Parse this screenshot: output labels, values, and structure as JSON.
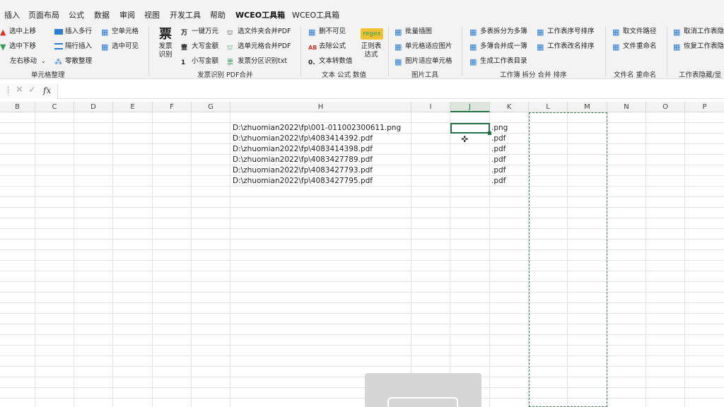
{
  "menu": {
    "items": [
      "插入",
      "页面布局",
      "公式",
      "数据",
      "审阅",
      "视图",
      "开发工具",
      "帮助",
      "WCEO工具箱",
      "WCEO工具箱"
    ]
  },
  "ribbon": {
    "cell_org": {
      "move_up": "选中上移",
      "move_down": "选中下移",
      "move_lr": "左右移动",
      "insert_rows": "插入多行",
      "interlace_insert": "隔行插入",
      "scatter_tidy": "零散整理",
      "empty_cells": "空单元格",
      "select_visible": "选中可见",
      "group_label": "单元格整理"
    },
    "invoice": {
      "invoice_icon": "票",
      "invoice_recognize": "发票识别",
      "one_key_wan": "一键万元",
      "upper_amount": "大写金额",
      "lower_amount": "小写金额",
      "folder_pdf": "选文件夹合并PDF",
      "cells_pdf": "选单元格合并PDF",
      "invoice_txt": "发票分区识别txt",
      "group_label": "发票识别 PDF合并"
    },
    "text": {
      "del_invisible": "删不可见",
      "remove_formula": "去除公式",
      "text_to_num": "文本转数值",
      "regex_icon": "regex",
      "regex_label": "正则表达式",
      "group_label": "文本 公式 数值"
    },
    "image": {
      "batch_insert": "批量插图",
      "cell_fit_image": "单元格适应图片",
      "image_fit_cell": "图片适应单元格",
      "group_label": "图片工具"
    },
    "workbook": {
      "split_multi": "多表拆分为多簿",
      "merge_multi": "多簿合并成一簿",
      "gen_dir": "生成工作表目录",
      "sort_order": "工作表序号排序",
      "sort_name": "工作表改名排序",
      "group_label": "工作簿 拆分 合并 排序"
    },
    "filename": {
      "get_path": "取文件路径",
      "rename": "文件重命名",
      "group_label": "文件名 重命名"
    },
    "sheet": {
      "cancel_hide": "取消工作表隐",
      "restore_hide": "恢复工作表隐",
      "group_label": "工作表隐藏/显"
    }
  },
  "formula_bar": {
    "fx": "fx",
    "value": ""
  },
  "columns": [
    "B",
    "C",
    "D",
    "E",
    "F",
    "G",
    "H",
    "I",
    "J",
    "K",
    "L",
    "M",
    "N",
    "O",
    "P"
  ],
  "sheet": {
    "paths": [
      "D:\\zhuomian2022\\fp\\001-011002300611.png",
      "D:\\zhuomian2022\\fp\\4083414392.pdf",
      "D:\\zhuomian2022\\fp\\4083414398.pdf",
      "D:\\zhuomian2022\\fp\\4083427789.pdf",
      "D:\\zhuomian2022\\fp\\4083427793.pdf",
      "D:\\zhuomian2022\\fp\\4083427795.pdf"
    ],
    "extensions": [
      ".png",
      ".pdf",
      ".pdf",
      ".pdf",
      ".pdf",
      ".pdf"
    ]
  },
  "colors": {
    "accent": "#217346",
    "ribbon_bg": "#f3f3f3",
    "icon_blue": "#2b7bd3",
    "icon_red": "#d9342b",
    "icon_green": "#2e9b57",
    "regex_bg": "#f1c232"
  }
}
